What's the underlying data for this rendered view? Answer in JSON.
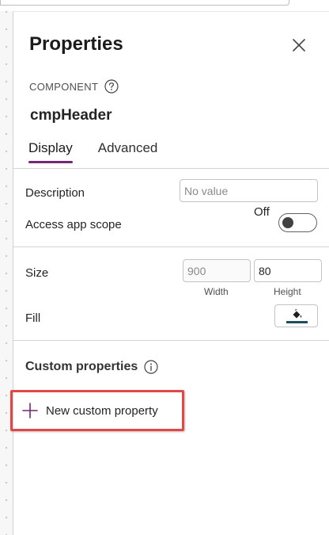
{
  "panel": {
    "title": "Properties",
    "close_icon": "close-icon",
    "component_label": "COMPONENT",
    "help_icon": "question-circle-icon",
    "component_name": "cmpHeader"
  },
  "tabs": [
    {
      "label": "Display",
      "active": true
    },
    {
      "label": "Advanced",
      "active": false
    }
  ],
  "display": {
    "description_label": "Description",
    "description_placeholder": "No value",
    "access_scope_label": "Access app scope",
    "access_scope_state": "Off",
    "size_label": "Size",
    "width_value": "900",
    "height_value": "80",
    "width_caption": "Width",
    "height_caption": "Height",
    "fill_label": "Fill",
    "fill_icon": "paint-bucket-icon",
    "fill_color": "#1f4e5f"
  },
  "custom": {
    "section_title": "Custom properties",
    "info_icon": "info-icon",
    "new_property_label": "New custom property",
    "add_icon": "plus-icon",
    "accent_color": "#742774",
    "highlight_color": "#e04848"
  }
}
